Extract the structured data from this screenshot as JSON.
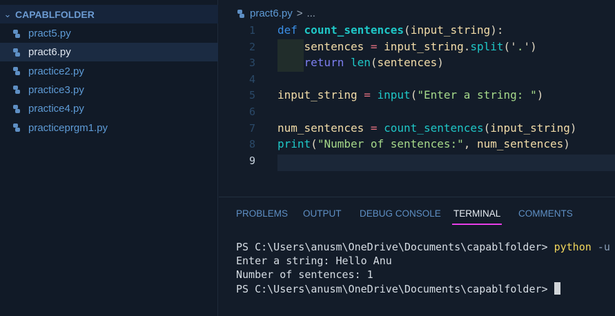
{
  "sidebar": {
    "folder": "CAPABLFOLDER",
    "files": [
      "pract5.py",
      "pract6.py",
      "practice2.py",
      "practice3.py",
      "practice4.py",
      "practiceprgm1.py"
    ],
    "selected": "pract6.py"
  },
  "breadcrumb": {
    "file": "pract6.py",
    "sep": ">",
    "rest": "..."
  },
  "editor": {
    "line_numbers": [
      "1",
      "2",
      "3",
      "4",
      "5",
      "6",
      "7",
      "8",
      "9"
    ],
    "current_line": 9,
    "lines": [
      [
        [
          "def",
          "k"
        ],
        [
          " ",
          "p"
        ],
        [
          "count_sentences",
          "f"
        ],
        [
          "(",
          "p"
        ],
        [
          "input_string",
          "v"
        ],
        [
          "):",
          "p"
        ]
      ],
      [
        [
          "    ",
          "p"
        ],
        [
          "sentences",
          "v"
        ],
        [
          " = ",
          "o"
        ],
        [
          "input_string",
          "v"
        ],
        [
          ".",
          "p"
        ],
        [
          "split",
          "fn"
        ],
        [
          "('",
          "p"
        ],
        [
          ".",
          "s"
        ],
        [
          "')",
          "p"
        ]
      ],
      [
        [
          "    ",
          "p"
        ],
        [
          "return",
          "r"
        ],
        [
          " ",
          "p"
        ],
        [
          "len",
          "fn"
        ],
        [
          "(",
          "p"
        ],
        [
          "sentences",
          "v"
        ],
        [
          ")",
          "p"
        ]
      ],
      [],
      [
        [
          "input_string",
          "v"
        ],
        [
          " = ",
          "o"
        ],
        [
          "input",
          "fn"
        ],
        [
          "(",
          "p"
        ],
        [
          "\"Enter a string: \"",
          "s"
        ],
        [
          ")",
          "p"
        ]
      ],
      [],
      [
        [
          "num_sentences",
          "v"
        ],
        [
          " = ",
          "o"
        ],
        [
          "count_sentences",
          "fn"
        ],
        [
          "(",
          "p"
        ],
        [
          "input_string",
          "v"
        ],
        [
          ")",
          "p"
        ]
      ],
      [
        [
          "print",
          "fn"
        ],
        [
          "(",
          "p"
        ],
        [
          "\"Number of sentences:\"",
          "s"
        ],
        [
          ", ",
          "p"
        ],
        [
          "num_sentences",
          "v"
        ],
        [
          ")",
          "p"
        ]
      ],
      []
    ]
  },
  "panel": {
    "tabs": [
      "PROBLEMS",
      "OUTPUT",
      "DEBUG CONSOLE",
      "TERMINAL",
      "COMMENTS"
    ],
    "active": "TERMINAL"
  },
  "terminal": {
    "prompt": "PS C:\\Users\\anusm\\OneDrive\\Documents\\capablfolder> ",
    "cmd": "python",
    "flag": " -u",
    "line2": "Enter a string: Hello Anu",
    "line3": "Number of sentences: 1",
    "prompt2": "PS C:\\Users\\anusm\\OneDrive\\Documents\\capablfolder> "
  },
  "colors": {
    "accent_tab": "#e83ee8",
    "selection": "#1b2b42"
  }
}
